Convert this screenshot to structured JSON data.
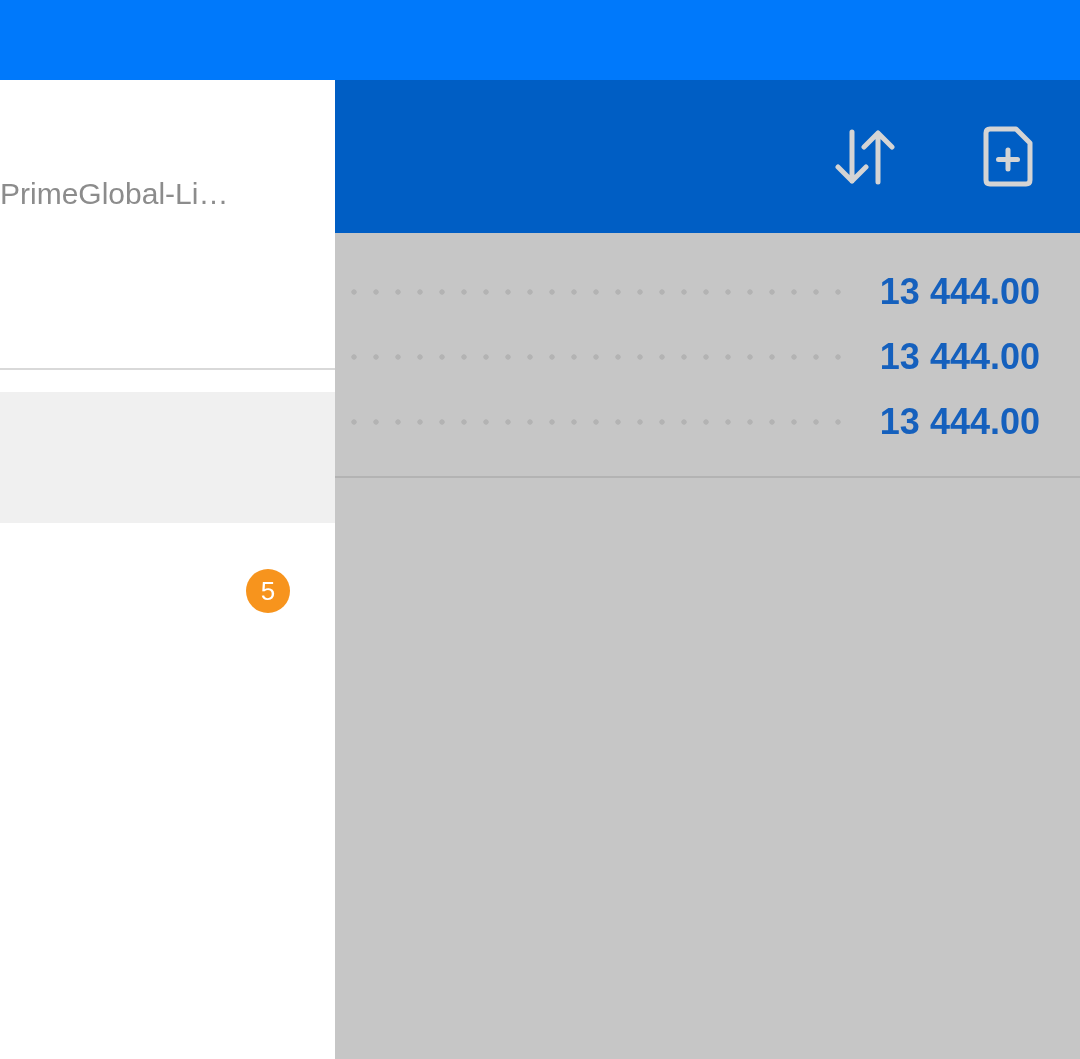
{
  "drawer": {
    "server": "PrimeGlobal-Li…",
    "menu_items": [
      {
        "selected": true
      },
      {
        "selected": false,
        "badge": "5"
      }
    ]
  },
  "toolbar": {
    "actions": [
      {
        "kind": "sort"
      },
      {
        "kind": "new-document"
      }
    ]
  },
  "rows": [
    {
      "value": "13 444.00"
    },
    {
      "value": "13 444.00"
    },
    {
      "value": "13 444.00"
    }
  ]
}
